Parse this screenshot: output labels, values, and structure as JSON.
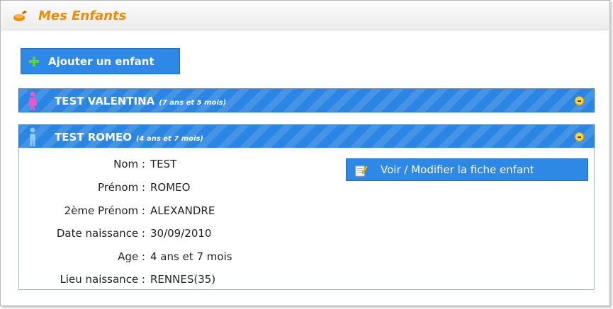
{
  "panel": {
    "title": "Mes Enfants",
    "title_icon": "pan-icon",
    "title_color": "#f08a00"
  },
  "actions": {
    "add_child_label": "Ajouter un enfant"
  },
  "children": [
    {
      "name": "TEST VALENTINA",
      "age": "(7 ans et 5 mois)",
      "gender_icon": "female-person-icon",
      "expanded": false
    },
    {
      "name": "TEST ROMEO",
      "age": "(4 ans et 7 mois)",
      "gender_icon": "male-person-icon",
      "expanded": true,
      "details": [
        {
          "label": "Nom :",
          "value": "TEST"
        },
        {
          "label": "Prénom :",
          "value": "ROMEO"
        },
        {
          "label": "2ème Prénom :",
          "value": "ALEXANDRE"
        },
        {
          "label": "Date naissance :",
          "value": "30/09/2010"
        },
        {
          "label": "Age :",
          "value": "4 ans et 7 mois"
        },
        {
          "label": "Lieu naissance :",
          "value": "RENNES(35)"
        }
      ],
      "edit_label": "Voir / Modifier la fiche enfant"
    }
  ],
  "colors": {
    "accent_blue": "#2a86e2",
    "female_pink": "#e85ac8",
    "male_blue": "#8ec6ff",
    "toggle_yellow": "#ffd43a"
  }
}
